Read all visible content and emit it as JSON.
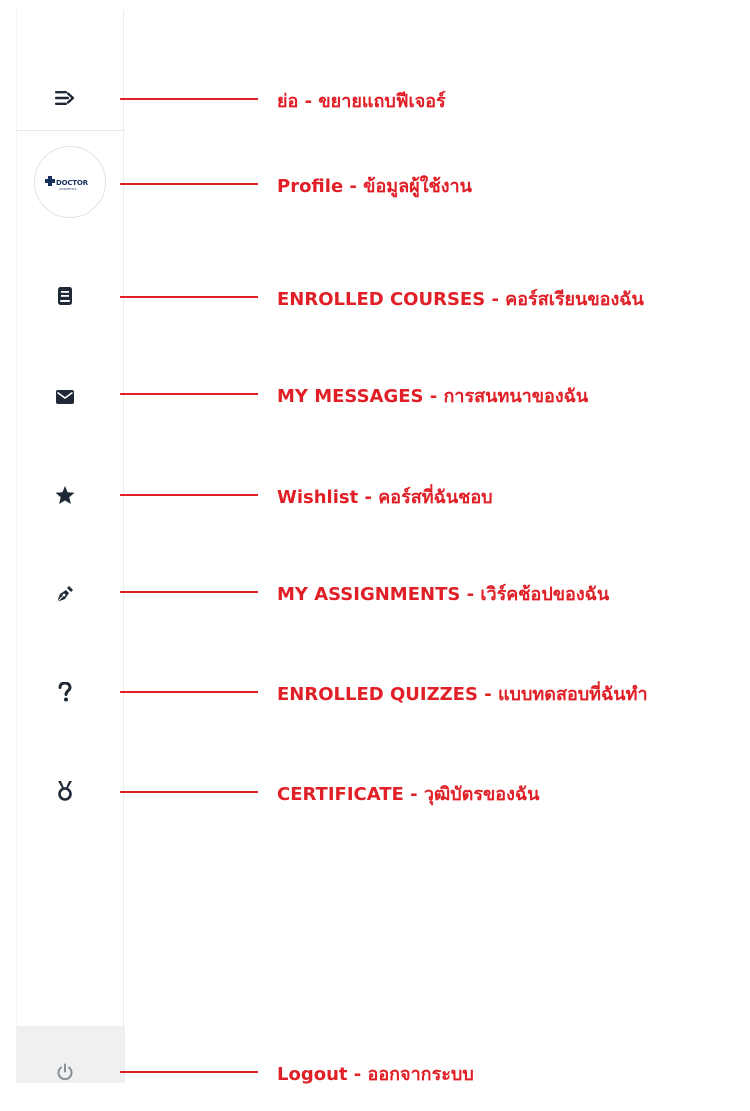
{
  "sidebar": {
    "avatar": {
      "brand": "DOCTOR",
      "brand_sub": "COSMETICS"
    }
  },
  "annotations": [
    {
      "label": "ย่อ - ขยายแถบฟีเจอร์"
    },
    {
      "label": "Profile - ข้อมูลผู้ใช้งาน"
    },
    {
      "label": "ENROLLED COURSES - คอร์สเรียนของฉัน"
    },
    {
      "label": "MY MESSAGES - การสนทนาของฉัน"
    },
    {
      "label": "Wishlist - คอร์สที่ฉันชอบ"
    },
    {
      "label": "MY ASSIGNMENTS - เวิร์คช้อปของฉัน"
    },
    {
      "label": "ENROLLED QUIZZES - แบบทดสอบที่ฉันทำ"
    },
    {
      "label": "CERTIFICATE - วุฒิบัตรของฉัน"
    },
    {
      "label": "Logout - ออกจากระบบ"
    }
  ],
  "icons": {
    "toggle": "sidebar-toggle-icon",
    "courses": "book-icon",
    "messages": "envelope-icon",
    "wishlist": "star-icon",
    "assignments": "pen-nib-icon",
    "quizzes": "question-mark-icon",
    "certificate": "medal-icon",
    "logout": "power-icon"
  },
  "colors": {
    "annotation": "#e01f26",
    "icon": "#1f2a36",
    "logout_icon": "#8a8f96",
    "brand": "#17305e"
  }
}
